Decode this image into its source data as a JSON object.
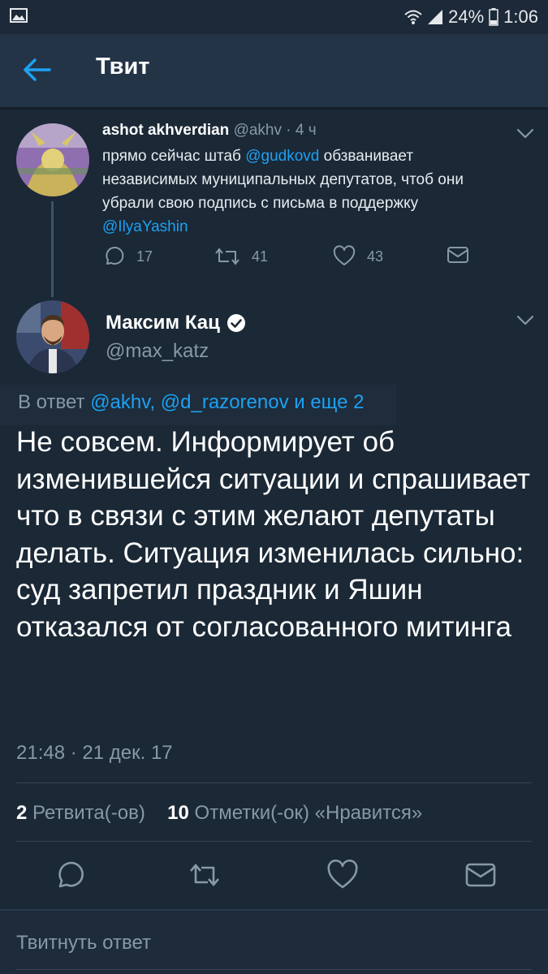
{
  "status_bar": {
    "battery": "24%",
    "time": "1:06"
  },
  "header": {
    "title": "Твит"
  },
  "parent_tweet": {
    "name": "ashot akhverdian",
    "handle": "@akhv",
    "separator": "·",
    "time": "4 ч",
    "text_parts": [
      {
        "text": "прямо сейчас штаб ",
        "mention": false
      },
      {
        "text": "@gudkovd",
        "mention": true
      },
      {
        "text": " обзванивает независимых муниципальных депутатов, чтоб они убрали свою подпись с письма в поддержку ",
        "mention": false
      },
      {
        "text": "@IlyaYashin",
        "mention": true
      }
    ],
    "replies": "17",
    "retweets": "41",
    "likes": "43"
  },
  "main_tweet": {
    "name": "Максим Кац",
    "handle": "@max_katz",
    "reply_prefix": "В ответ ",
    "reply_targets": "@akhv, @d_razorenov и еще 2",
    "text": "Не совсем. Информирует об изменившейся ситуации и спрашивает что в связи с этим желают депутаты делать. Ситуация изменилась сильно: суд запретил праздник и Яшин отказался от согласованного митинга",
    "timestamp": "21:48 · 21 дек. 17",
    "retweets_count": "2",
    "retweets_label": "Ретвита(-ов)",
    "likes_count": "10",
    "likes_label": "Отметки(-ок) «Нравится»"
  },
  "reply_box": {
    "placeholder": "Твитнуть ответ"
  },
  "colors": {
    "background": "#1b2836",
    "appbar": "#243447",
    "accent": "#1da1f2",
    "secondary_text": "#8899a6"
  }
}
